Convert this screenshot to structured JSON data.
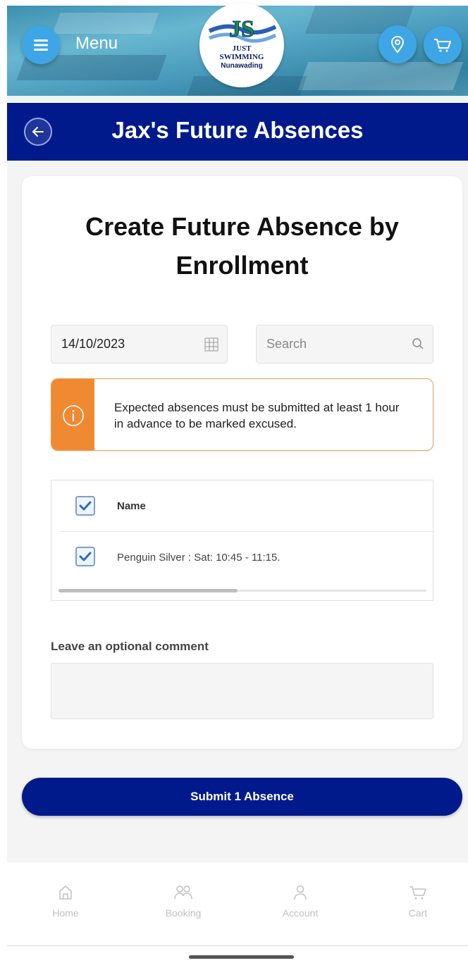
{
  "header": {
    "menu_label": "Menu",
    "logo": {
      "line1": "JS",
      "line2": "JUST",
      "line3": "SWIMMING",
      "line4": "Nunawading"
    }
  },
  "title_bar": {
    "title": "Jax's Future Absences"
  },
  "card": {
    "title": "Create Future Absence by Enrollment",
    "date_value": "14/10/2023",
    "search_placeholder": "Search",
    "alert_text": "Expected absences must be submitted at least 1 hour in advance to be marked excused.",
    "table": {
      "header_name": "Name",
      "rows": [
        {
          "name": "Penguin Silver : Sat: 10:45 - 11:15.",
          "checked": true
        }
      ],
      "header_checked": true
    },
    "comment_label": "Leave an optional comment",
    "comment_value": ""
  },
  "submit_label": "Submit 1 Absence",
  "bottom_nav": [
    {
      "label": "Home",
      "icon": "home-icon"
    },
    {
      "label": "Booking",
      "icon": "people-icon"
    },
    {
      "label": "Account",
      "icon": "person-icon"
    },
    {
      "label": "Cart",
      "icon": "cart-icon"
    }
  ],
  "colors": {
    "brand_navy": "#001a8c",
    "accent_blue": "#3ea6e6",
    "alert_orange": "#ef8a32"
  }
}
